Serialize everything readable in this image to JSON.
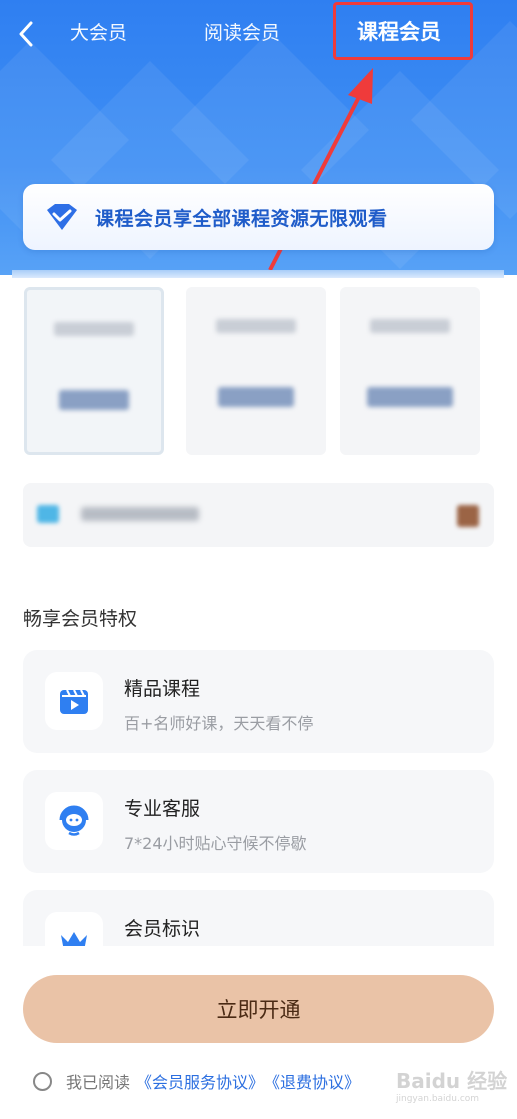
{
  "header": {
    "tabs": [
      {
        "label": "大会员",
        "active": false
      },
      {
        "label": "阅读会员",
        "active": false
      },
      {
        "label": "课程会员",
        "active": true
      }
    ],
    "banner_text": "课程会员享全部课程资源无限观看"
  },
  "colors": {
    "header_blue": "#2f7ff1",
    "annotation_red": "#ef3b3b",
    "cta_bg": "#eac3a7",
    "link_blue": "#2c6fe0"
  },
  "plans_note": "plan names and prices are blurred in the screenshot",
  "privileges": {
    "title": "畅享会员特权",
    "items": [
      {
        "icon": "video-course-icon",
        "title": "精品课程",
        "desc": "百+名师好课，天天看不停"
      },
      {
        "icon": "customer-service-icon",
        "title": "专业客服",
        "desc": "7*24小时贴心守候不停歇"
      },
      {
        "icon": "crown-icon",
        "title": "会员标识",
        "desc": ""
      }
    ]
  },
  "cta": {
    "label": "立即开通"
  },
  "agreement": {
    "prefix": "我已阅读",
    "link1": "《会员服务协议》",
    "link2": "《退费协议》"
  },
  "watermark": {
    "text": "Baidu 经验",
    "sub": "jingyan.baidu.com"
  }
}
